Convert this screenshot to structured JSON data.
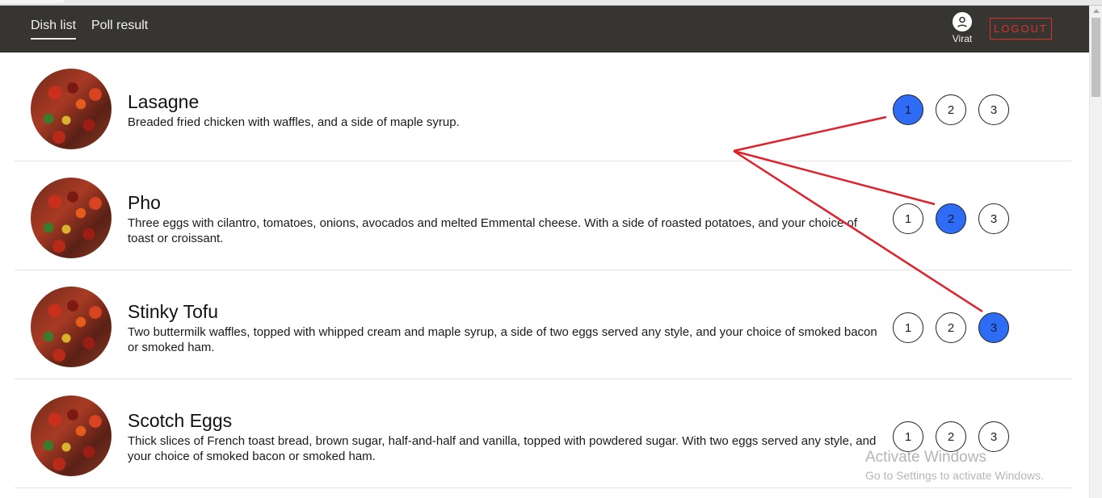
{
  "nav": {
    "links": [
      "Dish list",
      "Poll result"
    ],
    "user_name": "Virat",
    "logout_label": "LOGOUT"
  },
  "colors": {
    "navbar_bg": "#363532",
    "selected_vote": "#2f6cf5",
    "logout_accent": "#e0302a",
    "annotation": "#e0202a"
  },
  "dishes": [
    {
      "name": "Lasagne",
      "description": "Breaded fried chicken with waffles, and a side of maple syrup.",
      "vote_options": [
        "1",
        "2",
        "3"
      ],
      "selected": "1"
    },
    {
      "name": "Pho",
      "description": "Three eggs with cilantro, tomatoes, onions, avocados and melted Emmental cheese. With a side of roasted potatoes, and your choice of toast or croissant.",
      "vote_options": [
        "1",
        "2",
        "3"
      ],
      "selected": "2"
    },
    {
      "name": "Stinky Tofu",
      "description": "Two buttermilk waffles, topped with whipped cream and maple syrup, a side of two eggs served any style, and your choice of smoked bacon or smoked ham.",
      "vote_options": [
        "1",
        "2",
        "3"
      ],
      "selected": "3"
    },
    {
      "name": "Scotch Eggs",
      "description": "Thick slices of French toast bread, brown sugar, half-and-half and vanilla, topped with powdered sugar. With two eggs served any style, and your choice of smoked bacon or smoked ham.",
      "vote_options": [
        "1",
        "2",
        "3"
      ],
      "selected": null
    }
  ],
  "watermark": {
    "title": "Activate Windows",
    "subtitle": "Go to Settings to activate Windows."
  }
}
